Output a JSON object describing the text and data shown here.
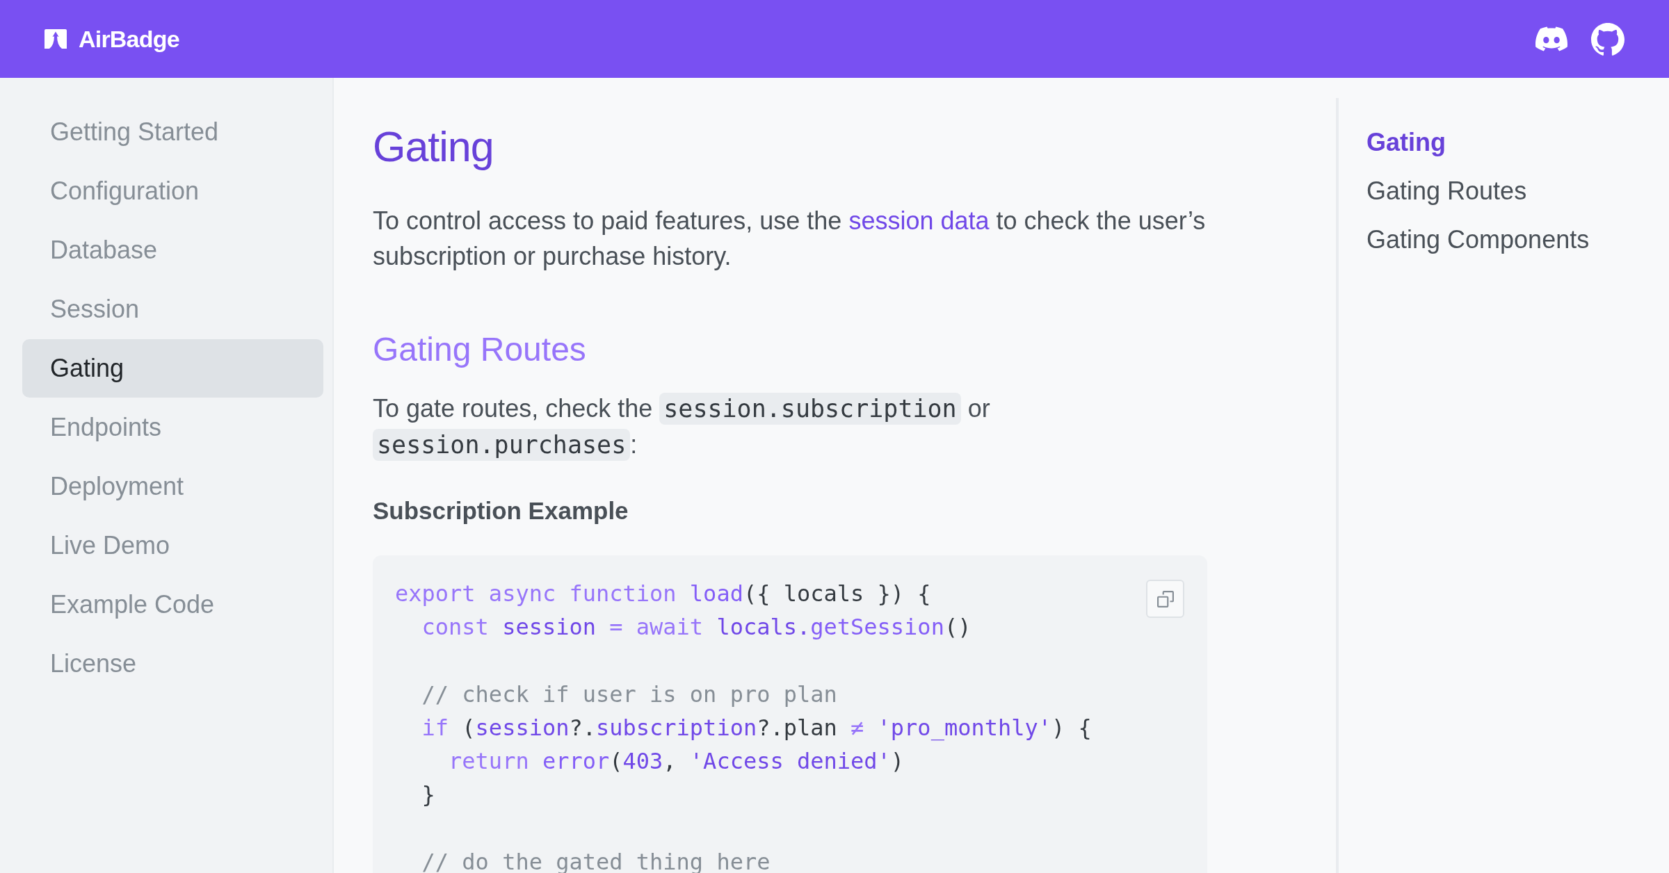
{
  "header": {
    "brand": "AirBadge"
  },
  "sidebar": {
    "items": [
      {
        "label": "Getting Started",
        "selected": false
      },
      {
        "label": "Configuration",
        "selected": false
      },
      {
        "label": "Database",
        "selected": false
      },
      {
        "label": "Session",
        "selected": false
      },
      {
        "label": "Gating",
        "selected": true
      },
      {
        "label": "Endpoints",
        "selected": false
      },
      {
        "label": "Deployment",
        "selected": false
      },
      {
        "label": "Live Demo",
        "selected": false
      },
      {
        "label": "Example Code",
        "selected": false
      },
      {
        "label": "License",
        "selected": false
      }
    ]
  },
  "article": {
    "title": "Gating",
    "intro": [
      {
        "kind": "text",
        "text": "To control access to paid features, use the "
      },
      {
        "kind": "link",
        "text": "session data"
      },
      {
        "kind": "text",
        "text": " to check the user’s subscription or purchase history."
      }
    ],
    "sections": [
      {
        "heading": "Gating Routes",
        "body": [
          {
            "kind": "text",
            "text": "To gate routes, check the "
          },
          {
            "kind": "code",
            "text": "session.subscription"
          },
          {
            "kind": "text",
            "text": " or "
          },
          {
            "kind": "code",
            "text": "session.purchases"
          },
          {
            "kind": "text",
            "text": ":"
          }
        ],
        "example_title": "Subscription Example",
        "code_lines": [
          {
            "kind": "code",
            "tokens": [
              {
                "kind": "keyword",
                "text": "export async function "
              },
              {
                "kind": "function",
                "text": "load"
              },
              {
                "kind": "plain",
                "text": "({ locals }) {"
              }
            ]
          },
          {
            "kind": "code",
            "tokens": [
              {
                "kind": "keyword",
                "text": "  const "
              },
              {
                "kind": "variable",
                "text": "session"
              },
              {
                "kind": "operator",
                "text": " = "
              },
              {
                "kind": "keyword",
                "text": "await "
              },
              {
                "kind": "variable",
                "text": "locals."
              },
              {
                "kind": "function",
                "text": "getSession"
              },
              {
                "kind": "plain",
                "text": "()"
              }
            ]
          },
          {
            "kind": "blank"
          },
          {
            "kind": "code",
            "tokens": [
              {
                "kind": "comment",
                "text": "  // check if user is on pro plan"
              }
            ]
          },
          {
            "kind": "code",
            "tokens": [
              {
                "kind": "keyword",
                "text": "  if "
              },
              {
                "kind": "plain",
                "text": "("
              },
              {
                "kind": "variable",
                "text": "session"
              },
              {
                "kind": "plain",
                "text": "?."
              },
              {
                "kind": "variable",
                "text": "subscription"
              },
              {
                "kind": "plain",
                "text": "?.plan "
              },
              {
                "kind": "operator",
                "text": "≠ "
              },
              {
                "kind": "string",
                "text": "'pro_monthly'"
              },
              {
                "kind": "plain",
                "text": ") {"
              }
            ]
          },
          {
            "kind": "code",
            "tokens": [
              {
                "kind": "keyword",
                "text": "    return "
              },
              {
                "kind": "function",
                "text": "error"
              },
              {
                "kind": "plain",
                "text": "("
              },
              {
                "kind": "number",
                "text": "403"
              },
              {
                "kind": "plain",
                "text": ", "
              },
              {
                "kind": "string",
                "text": "'Access denied'"
              },
              {
                "kind": "plain",
                "text": ")"
              }
            ]
          },
          {
            "kind": "code",
            "tokens": [
              {
                "kind": "plain",
                "text": "  }"
              }
            ]
          },
          {
            "kind": "blank"
          },
          {
            "kind": "code",
            "tokens": [
              {
                "kind": "comment",
                "text": "  // do the gated thing here"
              }
            ]
          }
        ]
      }
    ]
  },
  "toc": {
    "items": [
      {
        "label": "Gating",
        "selected": true
      },
      {
        "label": "Gating Routes",
        "selected": false
      },
      {
        "label": "Gating Components",
        "selected": false
      }
    ]
  }
}
